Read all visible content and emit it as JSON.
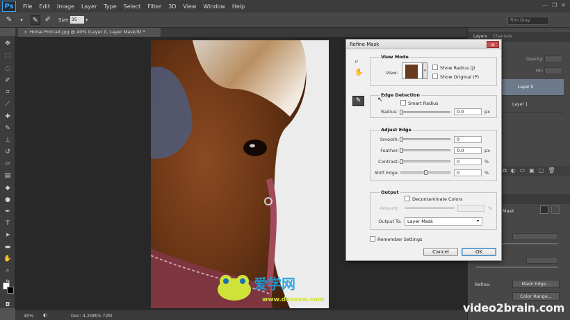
{
  "app": {
    "logo": "Ps"
  },
  "menu": [
    "File",
    "Edit",
    "Image",
    "Layer",
    "Type",
    "Select",
    "Filter",
    "3D",
    "View",
    "Window",
    "Help"
  ],
  "workspace": "Film Gray",
  "window_controls": [
    "—",
    "❐",
    "✕"
  ],
  "options": {
    "size_label": "Size:",
    "size_value": "35"
  },
  "doc_tab": "Horse Portrait.jpg @ 40% (Layer 0, Layer Mask/8) *",
  "status": {
    "zoom": "40%",
    "doc_size": "Doc: 4.29M/5.72M"
  },
  "panel": {
    "tabs": [
      "Layers",
      "Channels"
    ],
    "opacity_label": "Opacity:",
    "fill_label": "Fill:",
    "layers": [
      {
        "name": "Layer 0"
      },
      {
        "name": "Layer 1"
      }
    ],
    "mask_label": "Mask",
    "refine_label": "Refine:",
    "mask_edge_button": "Mask Edge...",
    "color_range_button": "Color Range..."
  },
  "dialog": {
    "title": "Refine Mask",
    "close": "✕",
    "view_mode": {
      "heading": "View Mode",
      "view_label": "View:",
      "show_radius": "Show Radius (J)",
      "show_original": "Show Original (P)"
    },
    "edge_detection": {
      "heading": "Edge Detection",
      "smart_radius": "Smart Radius",
      "radius_label": "Radius:",
      "radius_value": "0.0",
      "radius_unit": "px"
    },
    "adjust_edge": {
      "heading": "Adjust Edge",
      "smooth_label": "Smooth:",
      "smooth_value": "0",
      "feather_label": "Feather:",
      "feather_value": "0.0",
      "feather_unit": "px",
      "contrast_label": "Contrast:",
      "contrast_value": "0",
      "contrast_unit": "%",
      "shift_label": "Shift Edge:",
      "shift_value": "0",
      "shift_unit": "%"
    },
    "output": {
      "heading": "Output",
      "decontaminate": "Decontaminate Colors",
      "amount_label": "Amount:",
      "amount_unit": "%",
      "output_to_label": "Output To:",
      "output_to_value": "Layer Mask"
    },
    "remember": "Remember Settings",
    "cancel": "Cancel",
    "ok": "OK"
  },
  "watermarks": {
    "brand": "video2brain.com",
    "site_cn": "爱学网",
    "site_url": "www.dxsaxw.com"
  },
  "colors": {
    "accent_blue": "#31a8ff",
    "dialog_bg": "#f0f0f0",
    "panel_bg": "#474747",
    "layer_selected": "#6d7a8c"
  }
}
